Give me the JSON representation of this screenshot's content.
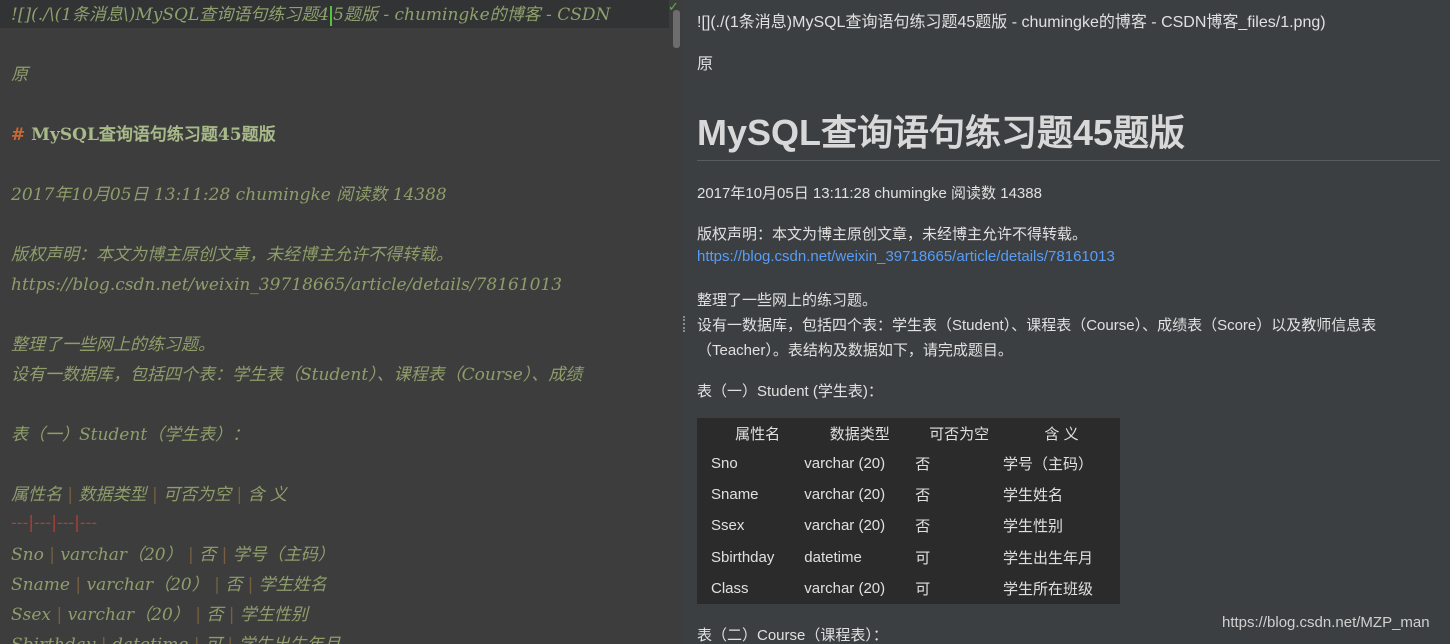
{
  "editor": {
    "line_top": [
      "![](./\\(1条消息\\)MySQL查询语句练习题4",
      "5题版 - chumingke的博客 - CSDN"
    ],
    "line_yuan": "原",
    "heading_hash": "#",
    "heading_text": "MySQL查询语句练习题45题版",
    "line_meta": "2017年10月05日 13:11:28 chumingke 阅读数 14388",
    "line_copyright": "版权声明：本文为博主原创文章，未经博主允许不得转载。",
    "line_url": "https://blog.csdn.net/weixin_39718665/article/details/78161013",
    "line_p1": "整理了一些网上的练习题。",
    "line_p2": "设有一数据库，包括四个表：学生表（Student）、课程表（Course）、成绩",
    "line_table_title": "表（一）Student（学生表）：",
    "table_header": [
      "属性名",
      "数据类型",
      "可否为空",
      "含 义"
    ],
    "table_sep": "---|---|---|---",
    "table_rows": [
      [
        "Sno",
        "varchar（20）",
        "否",
        "学号（主码）"
      ],
      [
        "Sname",
        "varchar（20）",
        "否",
        "学生姓名"
      ],
      [
        "Ssex",
        "varchar（20）",
        "否",
        "学生性别"
      ],
      [
        "Sbirthday",
        "datetime",
        "可",
        "学生出生年月"
      ]
    ]
  },
  "preview": {
    "image_text": "![](./(1条消息)MySQL查询语句练习题45题版 - chumingke的博客 - CSDN博客_files/1.png)",
    "yuan": "原",
    "title": "MySQL查询语句练习题45题版",
    "meta": "2017年10月05日 13:11:28 chumingke 阅读数 14388",
    "copyright": "版权声明：本文为博主原创文章，未经博主允许不得转载。",
    "link": "https://blog.csdn.net/weixin_39718665/article/details/78161013",
    "para1": "整理了一些网上的练习题。",
    "para2a": "设有一数据库，包括四个表：学生表（Student）、课程表（Course）、成绩表（Score）以及教师信息表",
    "para2b": "（Teacher）。表结构及数据如下，请完成题目。",
    "table1_title": "表（一）Student (学生表)：",
    "table_header": [
      "属性名",
      "数据类型",
      "可否为空",
      "含 义"
    ],
    "table_rows": [
      [
        "Sno",
        "varchar (20)",
        "否",
        "学号（主码）"
      ],
      [
        "Sname",
        "varchar (20)",
        "否",
        "学生姓名"
      ],
      [
        "Ssex",
        "varchar (20)",
        "否",
        "学生性别"
      ],
      [
        "Sbirthday",
        "datetime",
        "可",
        "学生出生年月"
      ],
      [
        "Class",
        "varchar (20)",
        "可",
        "学生所在班级"
      ]
    ],
    "table2_title": "表（二）Course（课程表）："
  },
  "watermark": "https://blog.csdn.net/MZP_man",
  "colors": {
    "editor_bg": "#3d3d3d",
    "preview_bg": "#3c3f41",
    "markdown_text": "#8f9d6a",
    "link": "#589df6",
    "table_sep": "#b04037",
    "caret": "#56c240"
  }
}
